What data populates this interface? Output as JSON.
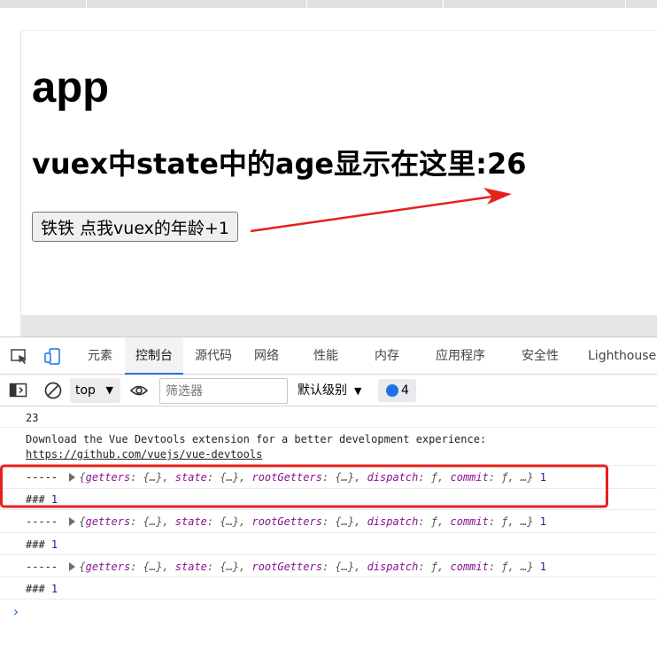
{
  "page": {
    "title": "app",
    "age_label": "vuex中state中的age显示在这里:",
    "age_value": "26",
    "button_label": "铁铁 点我vuex的年龄+1"
  },
  "devtools": {
    "tabs": [
      "元素",
      "控制台",
      "源代码",
      "网络",
      "性能",
      "内存",
      "应用程序",
      "安全性",
      "Lighthouse"
    ],
    "active_tab": "控制台",
    "toolbar": {
      "context": "top",
      "filter_placeholder": "筛选器",
      "level": "默认级别",
      "message_count": "4"
    },
    "console": {
      "line1": "23",
      "devtools_msg": "Download the Vue Devtools extension for a better development experience:",
      "devtools_link": "https://github.com/vuejs/vue-devtools",
      "log_prefix": "-----",
      "obj_open": "{",
      "k_getters": "getters",
      "k_state": "state",
      "k_rootGetters": "rootGetters",
      "k_dispatch": "dispatch",
      "k_commit": "commit",
      "v_obj": "{…}",
      "v_fn": "ƒ",
      "obj_tail": "…}",
      "log_num": "1",
      "hash_prefix": "###",
      "hash_num": "1"
    }
  },
  "colors": {
    "annotation_red": "#e5211b",
    "accent": "#1a73e8"
  }
}
